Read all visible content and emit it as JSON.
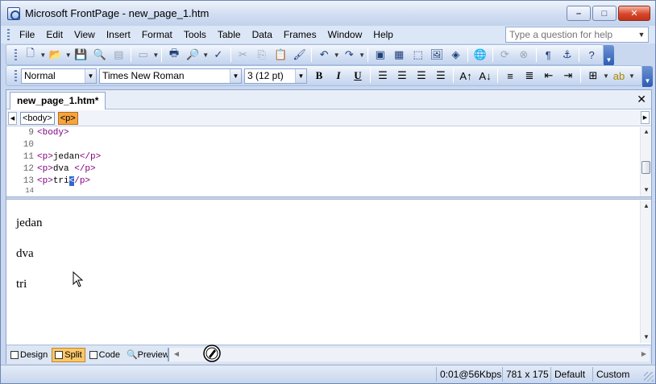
{
  "window": {
    "title": "Microsoft FrontPage - new_page_1.htm",
    "controls": [
      "–",
      "□",
      "✕"
    ]
  },
  "menubar": {
    "items": [
      "File",
      "Edit",
      "View",
      "Insert",
      "Format",
      "Tools",
      "Table",
      "Data",
      "Frames",
      "Window",
      "Help"
    ],
    "help_placeholder": "Type a question for help"
  },
  "format_toolbar": {
    "style": "Normal",
    "font": "Times New Roman",
    "size": "3  (12 pt)",
    "bold": "B",
    "italic": "I",
    "underline": "U"
  },
  "document": {
    "tab_label": "new_page_1.htm*",
    "tags": [
      "<body>",
      "<p>"
    ],
    "code_lines": [
      {
        "num": "9",
        "code": "<body>"
      },
      {
        "num": "10",
        "code": ""
      },
      {
        "num": "11",
        "code": "<p>",
        "text": "jedan",
        "close": "</p>"
      },
      {
        "num": "12",
        "code": "<p>",
        "text": "dva ",
        "close": "</p>"
      },
      {
        "num": "13",
        "code": "<p>",
        "text": "tri",
        "cursor": "<",
        "close": "/p>"
      },
      {
        "num": "14",
        "code": ""
      }
    ],
    "design_paragraphs": [
      "jedan",
      "dva",
      "tri"
    ]
  },
  "viewbar": {
    "design": "Design",
    "split": "Split",
    "code": "Code",
    "preview": "Preview"
  },
  "statusbar": {
    "speed": "0:01@56Kbps",
    "dimensions": "781 x 175",
    "mode": "Default",
    "custom": "Custom"
  }
}
